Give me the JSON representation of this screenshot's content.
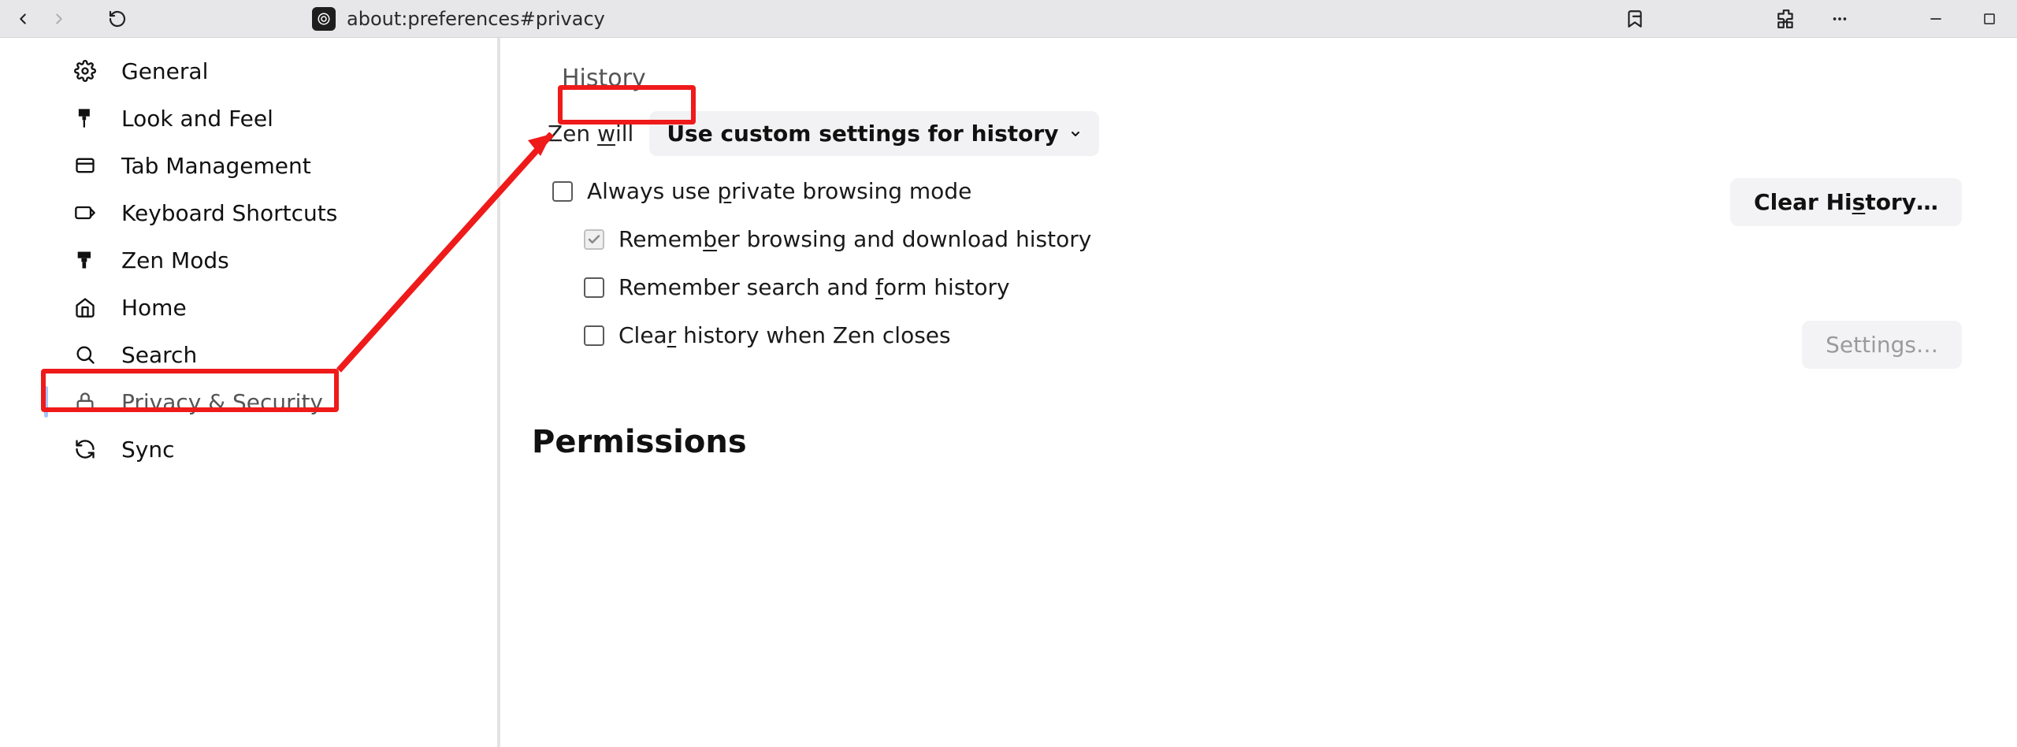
{
  "url": "about:preferences#privacy",
  "sidebar": {
    "items": [
      {
        "label": "General"
      },
      {
        "label": "Look and Feel"
      },
      {
        "label": "Tab Management"
      },
      {
        "label": "Keyboard Shortcuts"
      },
      {
        "label": "Zen Mods"
      },
      {
        "label": "Home"
      },
      {
        "label": "Search"
      },
      {
        "label": "Privacy & Security"
      },
      {
        "label": "Sync"
      }
    ]
  },
  "history": {
    "title": "History",
    "mode_prefix": "Zen ",
    "mode_underlined": "w",
    "mode_suffix": "ill",
    "mode_value": "Use custom settings for history",
    "opt_private": "Always use private browsing mode",
    "opt_private_u": "p",
    "opt_remember_browse": "Remember browsing and download history",
    "opt_remember_browse_u": "b",
    "opt_remember_search": "Remember search and form history",
    "opt_remember_search_u": "f",
    "opt_clear_close": "Clear history when Zen closes",
    "opt_clear_close_u": "r",
    "btn_clear": "Clear History…",
    "btn_clear_u": "s",
    "btn_settings": "Settings…"
  },
  "permissions": {
    "title": "Permissions"
  }
}
